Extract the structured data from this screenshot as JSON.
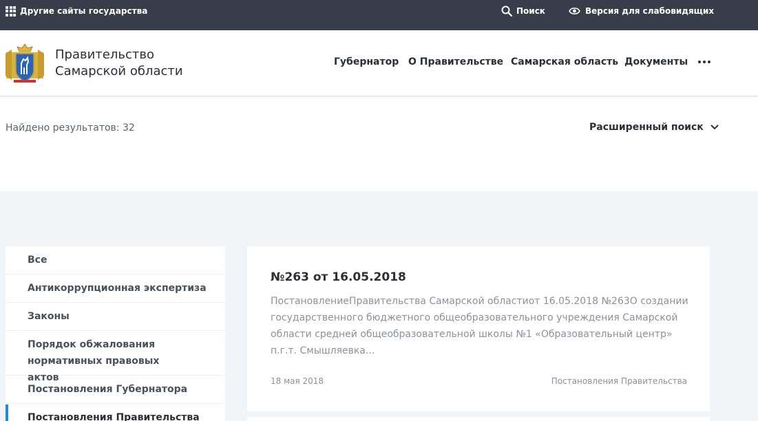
{
  "topbar": {
    "other_sites": "Другие сайты государства",
    "search": "Поиск",
    "vision": "Версия для слабовидящих"
  },
  "header": {
    "title_line1": "Правительство",
    "title_line2": "Самарской области",
    "nav": [
      "Губернатор",
      "О Правительстве",
      "Самарская область",
      "Документы"
    ]
  },
  "results": {
    "found": "Найдено результатов: 32",
    "advanced_search": "Расширенный поиск"
  },
  "sidebar": {
    "items": [
      "Все",
      "Антикоррупционная экспертиза",
      "Законы",
      "Порядок обжалования нормативных правовых актов",
      "Постановления Губернатора",
      "Постановления Правительства"
    ]
  },
  "card": {
    "title": "№263 от 16.05.2018",
    "text": "ПостановлениеПравительства Самарской областиот 16.05.2018 №263О создании государственного бюджетного общеобразовательного учреждения Самарской области средней общеобразовательной школы №1 «Образовательный центр» п.г.т. Смышляевка...",
    "date": "18 мая 2018",
    "type": "Постановления Правительства"
  },
  "colors": {
    "topbar_bg": "#373d4a",
    "page_bg": "#f2f5f8",
    "accent": "#1f8ed0"
  }
}
